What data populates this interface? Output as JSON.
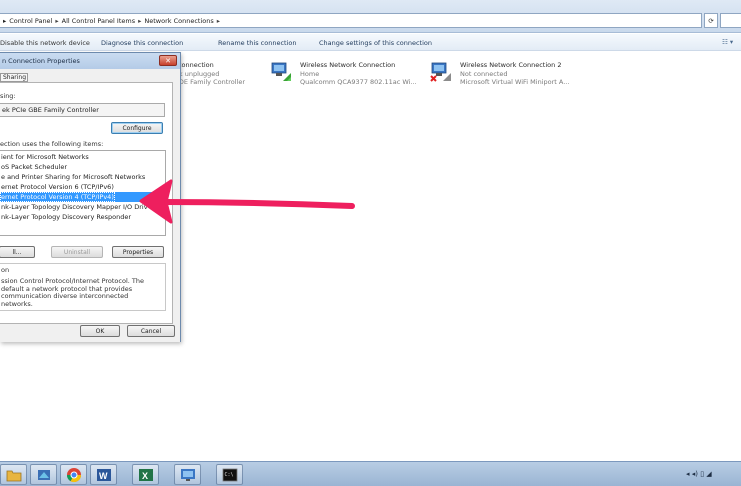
{
  "window": {
    "breadcrumbs": [
      "Control Panel",
      "All Control Panel Items",
      "Network Connections"
    ],
    "breadcrumb_separator": "▸",
    "refresh_icon": "refresh-icon"
  },
  "commandbar": {
    "disable": "Disable this network device",
    "diagnose": "Diagnose this connection",
    "rename": "Rename this connection",
    "change_settings": "Change settings of this connection"
  },
  "connections": [
    {
      "name": "Connection",
      "status": "Ik unplugged",
      "device": "iOE Family Controller"
    },
    {
      "name": "Wireless Network Connection",
      "status": "Home",
      "device": "Qualcomm QCA9377 802.11ac Wi..."
    },
    {
      "name": "Wireless Network Connection 2",
      "status": "Not connected",
      "device": "Microsoft Virtual WiFi Miniport A..."
    }
  ],
  "dialog": {
    "title": "n Connection Properties",
    "close_label": "✕",
    "tab_sharing": "Sharing",
    "connect_using_label": "sing:",
    "adapter": "ek PCIe GBE Family Controller",
    "configure_button": "Configure",
    "items_label": "ection uses the following items:",
    "items": [
      "ient for Microsoft Networks",
      "oS Packet Scheduler",
      "e and Printer Sharing for Microsoft Networks",
      "ernet Protocol Version 6 (TCP/IPv6)",
      "ernet Protocol Version 4 (TCP/IPv4)",
      "nk-Layer Topology Discovery Mapper I/O Driv",
      "nk-Layer Topology Discovery Responder"
    ],
    "selected_index": 4,
    "install_button": "ll...",
    "uninstall_button": "Uninstall",
    "properties_button": "Properties",
    "description_label": "on",
    "description": "ssion Control Protocol/Internet Protocol. The default a network protocol that provides communication diverse interconnected networks.",
    "ok_button": "OK",
    "cancel_button": "Cancel"
  },
  "annotation": {
    "color": "#ee1f5e"
  },
  "taskbar": {
    "apps": [
      "explorer",
      "media",
      "chrome",
      "word",
      "excel",
      "network",
      "cmd"
    ],
    "tray_icons": "◂ ◂) ▯ ◢"
  }
}
